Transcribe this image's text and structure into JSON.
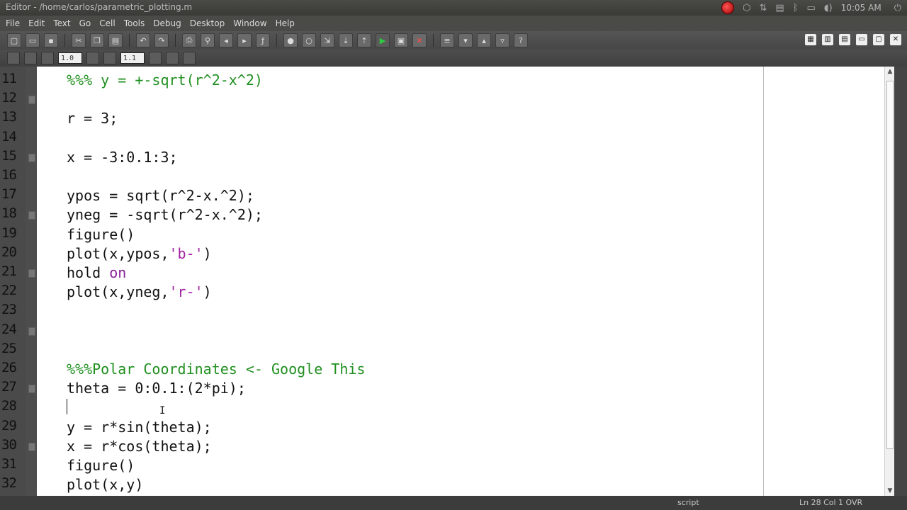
{
  "window": {
    "title": "Editor - /home/carlos/parametric_plotting.m",
    "clock": "10:05 AM"
  },
  "menu": [
    "File",
    "Edit",
    "Text",
    "Go",
    "Cell",
    "Tools",
    "Debug",
    "Desktop",
    "Window",
    "Help"
  ],
  "toolbar2": {
    "cell_decrement_value": "1.0",
    "cell_increment_value": "1.1"
  },
  "editor": {
    "line_numbers": [
      "11",
      "12",
      "13",
      "14",
      "15",
      "16",
      "17",
      "18",
      "19",
      "20",
      "21",
      "22",
      "23",
      "24",
      "25",
      "26",
      "27",
      "28",
      "29",
      "30",
      "31",
      "32"
    ],
    "lines": [
      [
        {
          "t": "%%% y = +-sqrt(r^2-x^2)",
          "c": "cmt"
        }
      ],
      [],
      [
        {
          "t": "r = 3;",
          "c": ""
        }
      ],
      [],
      [
        {
          "t": "x = -3:0.1:3;",
          "c": ""
        }
      ],
      [],
      [
        {
          "t": "ypos = sqrt(r^2-x.^2);",
          "c": ""
        }
      ],
      [
        {
          "t": "yneg = -sqrt(r^2-x.^2);",
          "c": ""
        }
      ],
      [
        {
          "t": "figure()",
          "c": ""
        }
      ],
      [
        {
          "t": "plot(x,ypos,",
          "c": ""
        },
        {
          "t": "'b-'",
          "c": "str"
        },
        {
          "t": ")",
          "c": ""
        }
      ],
      [
        {
          "t": "hold ",
          "c": ""
        },
        {
          "t": "on",
          "c": "kw"
        }
      ],
      [
        {
          "t": "plot(x,yneg,",
          "c": ""
        },
        {
          "t": "'r-'",
          "c": "str"
        },
        {
          "t": ")",
          "c": ""
        }
      ],
      [],
      [],
      [],
      [
        {
          "t": "%%%Polar Coordinates <- Google This",
          "c": "cmt"
        }
      ],
      [
        {
          "t": "theta = 0:0.1:(2*pi);",
          "c": ""
        }
      ],
      [],
      [
        {
          "t": "y = r*sin(theta);",
          "c": ""
        }
      ],
      [
        {
          "t": "x = r*cos(theta);",
          "c": ""
        }
      ],
      [
        {
          "t": "figure()",
          "c": ""
        }
      ],
      [
        {
          "t": "plot(x,y)",
          "c": ""
        }
      ]
    ]
  },
  "status": {
    "mode": "script",
    "position": "Ln 28   Col 1   OVR"
  }
}
